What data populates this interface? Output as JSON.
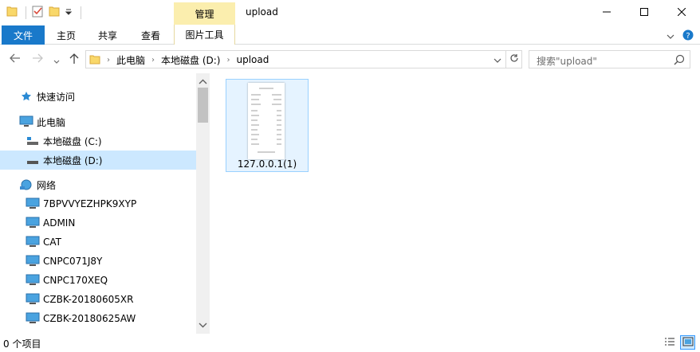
{
  "window": {
    "title": "upload",
    "context_tab": "管理",
    "controls": {
      "minimize_icon": "minimize-icon",
      "maximize_icon": "maximize-icon",
      "close_icon": "close-icon"
    }
  },
  "ribbon": {
    "file_tab": "文件",
    "tabs": [
      "主页",
      "共享",
      "查看"
    ],
    "picture_tools_tab": "图片工具"
  },
  "address": {
    "crumbs": [
      "此电脑",
      "本地磁盘 (D:)",
      "upload"
    ]
  },
  "search": {
    "placeholder": "搜索\"upload\""
  },
  "nav": {
    "items": [
      {
        "label": "快速访问",
        "icon": "star-icon"
      },
      {
        "label": "此电脑",
        "icon": "computer-icon"
      },
      {
        "label": "本地磁盘 (C:)",
        "icon": "drive-icon"
      },
      {
        "label": "本地磁盘 (D:)",
        "icon": "drive-icon"
      },
      {
        "label": "网络",
        "icon": "network-icon"
      },
      {
        "label": "7BPVVYEZHPK9XYP",
        "icon": "monitor-icon"
      },
      {
        "label": "ADMIN",
        "icon": "monitor-icon"
      },
      {
        "label": "CAT",
        "icon": "monitor-icon"
      },
      {
        "label": "CNPC071J8Y",
        "icon": "monitor-icon"
      },
      {
        "label": "CNPC170XEQ",
        "icon": "monitor-icon"
      },
      {
        "label": "CZBK-20180605XR",
        "icon": "monitor-icon"
      },
      {
        "label": "CZBK-20180625AW",
        "icon": "monitor-icon"
      }
    ]
  },
  "files": [
    {
      "name": "127.0.0.1(1)",
      "icon": "image-thumbnail"
    }
  ],
  "status": {
    "count_text": "0 个项目"
  },
  "colors": {
    "file_tab": "#1979ca",
    "context_tab": "#fbeeae",
    "selection": "#cce8ff",
    "selection_border": "#99d1ff"
  }
}
